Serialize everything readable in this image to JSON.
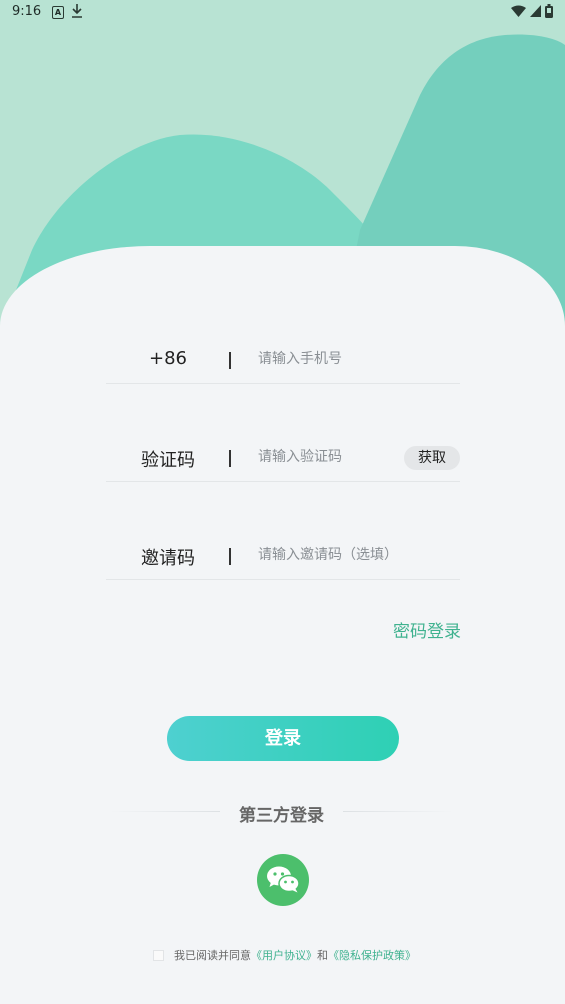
{
  "status_bar": {
    "time": "9:16",
    "icons": [
      "a-icon",
      "download-icon",
      "wifi-icon",
      "signal-icon",
      "battery-icon"
    ]
  },
  "form": {
    "phone": {
      "prefix": "+86",
      "placeholder": "请输入手机号",
      "value": ""
    },
    "code": {
      "label": "验证码",
      "placeholder": "请输入验证码",
      "value": "",
      "get_button": "获取"
    },
    "invite": {
      "label": "邀请码",
      "placeholder": "请输入邀请码（选填）",
      "value": ""
    }
  },
  "password_login_link": "密码登录",
  "login_button": "登录",
  "third_party": {
    "title": "第三方登录",
    "icons": [
      "wechat-icon"
    ]
  },
  "agreement": {
    "checked": false,
    "prefix": "我已阅读并同意",
    "user_agreement": "《用户协议》",
    "and": "和",
    "privacy_policy": "《隐私保护政策》"
  },
  "colors": {
    "background_top": "#b8e3d3",
    "hill": "#7ad8c4",
    "card": "#f3f5f7",
    "accent": "#3fb28f",
    "button_gradient_start": "#4ed0d0",
    "button_gradient_end": "#2ed0b4",
    "wechat": "#4cbf6c"
  }
}
